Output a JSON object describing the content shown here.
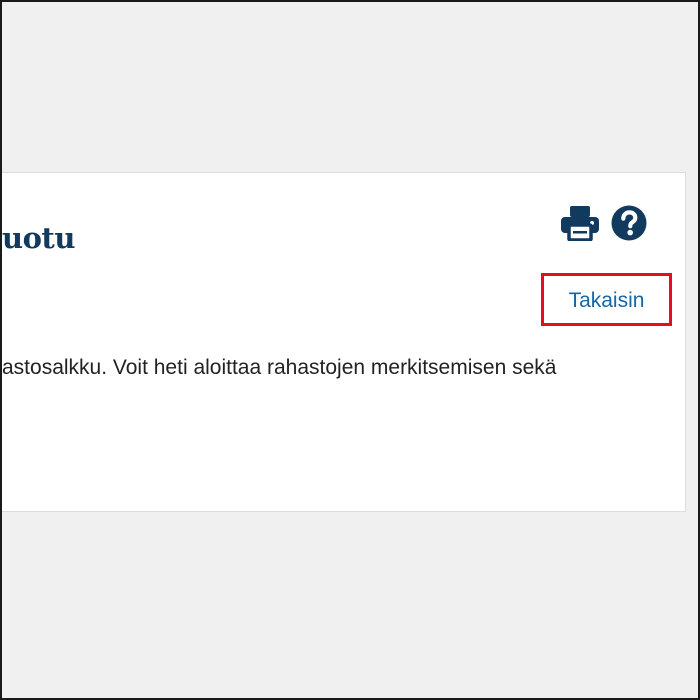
{
  "page": {
    "title": "uotu",
    "intro_text": "astosalkku. Voit heti aloittaa rahastojen merkitsemisen sekä"
  },
  "toolbar": {
    "print_icon": "print-icon",
    "help_icon": "help-icon"
  },
  "navigation": {
    "back_label": "Takaisin"
  },
  "colors": {
    "title": "#123a5e",
    "icon": "#123a5e",
    "link": "#1466a6",
    "highlight_border": "#e3101b",
    "page_background": "#f0f0f0",
    "card_background": "#ffffff"
  }
}
